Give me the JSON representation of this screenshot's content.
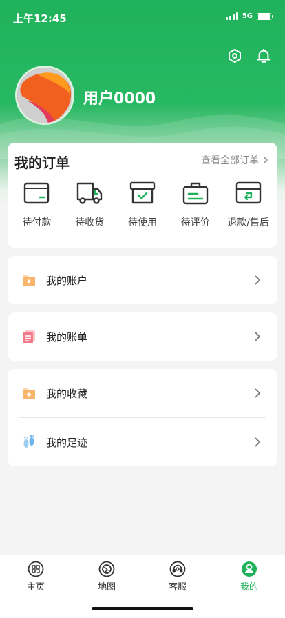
{
  "status_bar": {
    "time": "上午12:45",
    "network": "5G"
  },
  "header": {
    "settings_icon": "hexagon-settings-icon",
    "notification_icon": "bell-icon",
    "username": "用户0000"
  },
  "orders": {
    "title": "我的订单",
    "view_all": "查看全部订单",
    "items": [
      {
        "label": "待付款",
        "icon": "wallet-icon"
      },
      {
        "label": "待收货",
        "icon": "truck-icon"
      },
      {
        "label": "待使用",
        "icon": "box-check-icon"
      },
      {
        "label": "待评价",
        "icon": "clipboard-icon"
      },
      {
        "label": "退款/售后",
        "icon": "return-box-icon"
      }
    ]
  },
  "menu": {
    "account": {
      "label": "我的账户",
      "icon": "folder-star-icon"
    },
    "bill": {
      "label": "我的账单",
      "icon": "bill-icon"
    },
    "favorites": {
      "label": "我的收藏",
      "icon": "folder-star-icon"
    },
    "footprints": {
      "label": "我的足迹",
      "icon": "footprints-icon"
    }
  },
  "tabbar": {
    "items": [
      {
        "label": "主页",
        "icon": "qr-home-icon"
      },
      {
        "label": "地图",
        "icon": "globe-icon"
      },
      {
        "label": "客服",
        "icon": "headset-icon"
      },
      {
        "label": "我的",
        "icon": "user-icon",
        "active": true
      }
    ]
  },
  "colors": {
    "brand": "#20b25b",
    "order_icon_accent": "#20b25b"
  }
}
